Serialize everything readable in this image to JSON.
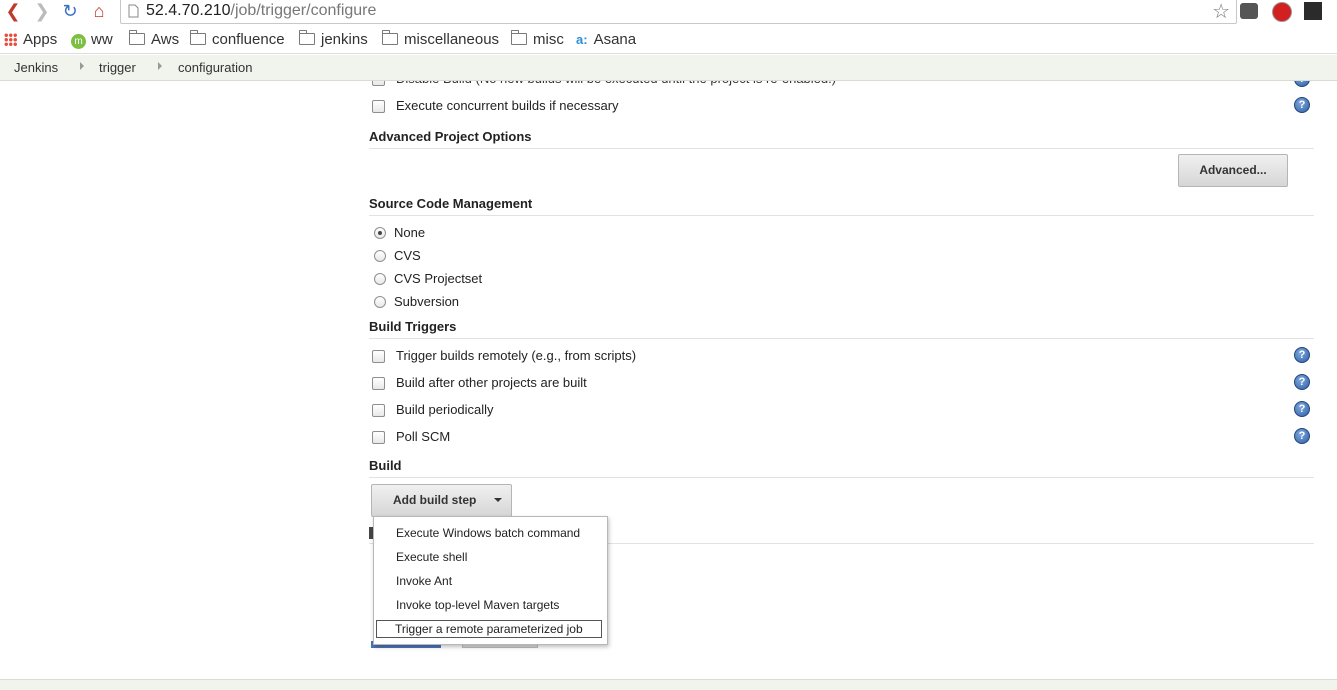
{
  "browser": {
    "url_host": "52.4.70.210",
    "url_path": "/job/trigger/configure",
    "bookmarks": [
      "Apps",
      "ww",
      "Aws",
      "confluence",
      "jenkins",
      "miscellaneous",
      "misc",
      "Asana"
    ]
  },
  "breadcrumb": [
    "Jenkins",
    "trigger",
    "configuration"
  ],
  "options": {
    "disable_build": "Disable Build (No new builds will be executed until the project is re-enabled.)",
    "concurrent": "Execute concurrent builds if necessary"
  },
  "advanced_project": {
    "title": "Advanced Project Options",
    "button": "Advanced..."
  },
  "scm": {
    "title": "Source Code Management",
    "options": [
      "None",
      "CVS",
      "CVS Projectset",
      "Subversion"
    ],
    "selected": "None"
  },
  "triggers": {
    "title": "Build Triggers",
    "options": [
      "Trigger builds remotely (e.g., from scripts)",
      "Build after other projects are built",
      "Build periodically",
      "Poll SCM"
    ]
  },
  "build": {
    "title": "Build",
    "add_step": "Add build step",
    "menu": [
      "Execute Windows batch command",
      "Execute shell",
      "Invoke Ant",
      "Invoke top-level Maven targets",
      "Trigger a remote parameterized job"
    ],
    "highlighted": "Trigger a remote parameterized job"
  },
  "colors": {
    "breadcrumb_bg": "#f0f4ec",
    "help_blue": "#2e5fa8"
  }
}
